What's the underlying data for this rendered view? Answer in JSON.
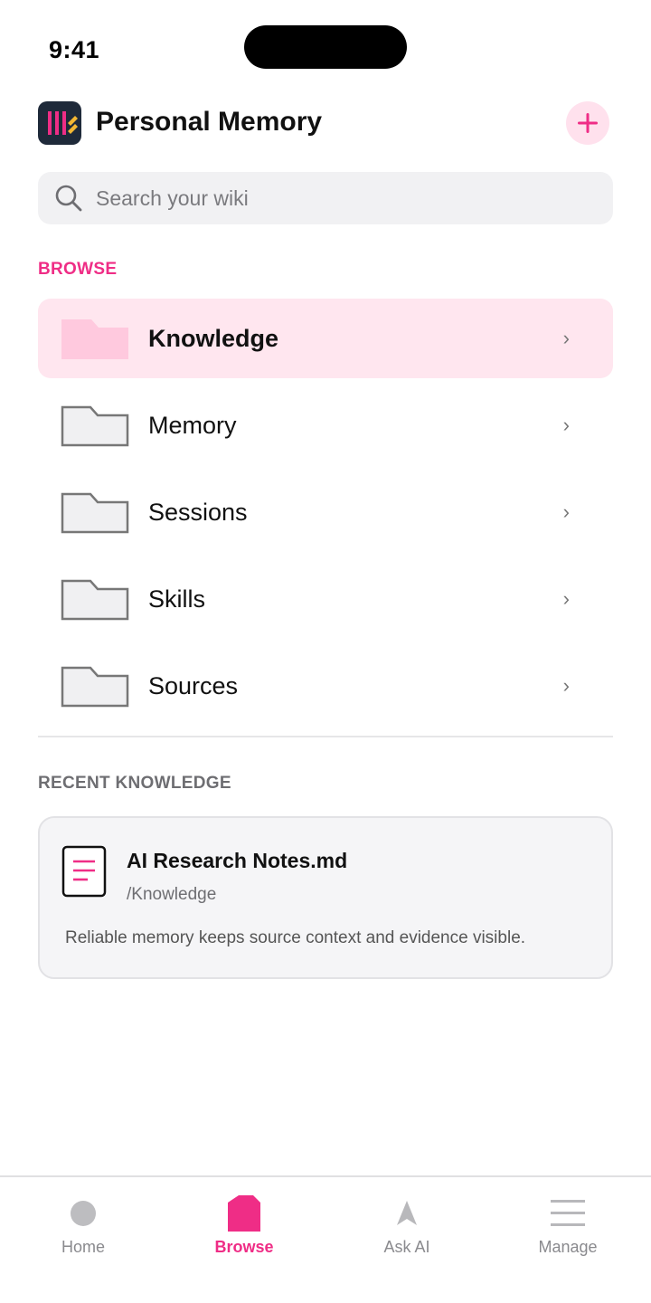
{
  "status_bar": {
    "time": "9:41"
  },
  "header": {
    "title": "Personal Memory",
    "logo_icon": "wiki-logo-icon",
    "add_icon": "plus-icon"
  },
  "search": {
    "placeholder": "Search your wiki",
    "value": "",
    "icon": "search-icon"
  },
  "browse": {
    "section_label": "BROWSE",
    "items": [
      {
        "label": "Knowledge",
        "active": true,
        "chevron": "›"
      },
      {
        "label": "Memory",
        "active": false,
        "chevron": "›"
      },
      {
        "label": "Sessions",
        "active": false,
        "chevron": "›"
      },
      {
        "label": "Skills",
        "active": false,
        "chevron": "›"
      },
      {
        "label": "Sources",
        "active": false,
        "chevron": "›"
      }
    ]
  },
  "recent": {
    "section_label": "RECENT KNOWLEDGE",
    "card": {
      "title": "AI Research Notes.md",
      "path": "/Knowledge",
      "description": "Reliable memory keeps source context and evidence visible."
    }
  },
  "tabbar": {
    "tabs": [
      {
        "label": "Home",
        "icon": "home-circle-icon",
        "active": false
      },
      {
        "label": "Browse",
        "icon": "browse-icon",
        "active": true
      },
      {
        "label": "Ask AI",
        "icon": "navigation-arrow-icon",
        "active": false
      },
      {
        "label": "Manage",
        "icon": "menu-lines-icon",
        "active": false
      }
    ]
  },
  "colors": {
    "accent": "#ef2d86",
    "accent_soft": "#ffe6ef",
    "folder_active": "#ffc9de",
    "logo_bg": "#1f2a3a"
  }
}
